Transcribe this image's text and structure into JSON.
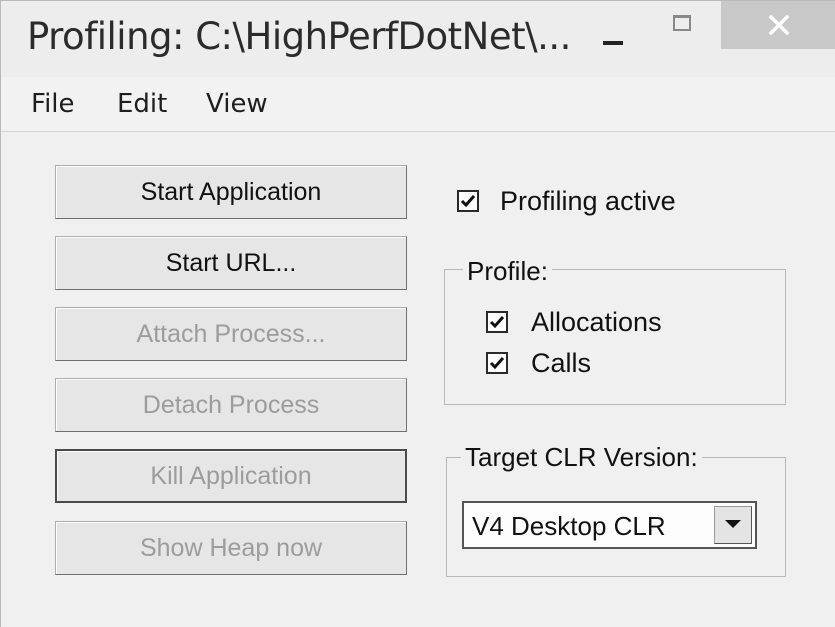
{
  "window": {
    "title": "Profiling: C:\\HighPerfDotNet\\..."
  },
  "menu": {
    "items": [
      {
        "label": "File"
      },
      {
        "label": "Edit"
      },
      {
        "label": "View"
      }
    ]
  },
  "actions": {
    "buttons": [
      {
        "label": "Start Application",
        "enabled": true
      },
      {
        "label": "Start URL...",
        "enabled": true
      },
      {
        "label": "Attach Process...",
        "enabled": false
      },
      {
        "label": "Detach Process",
        "enabled": false
      },
      {
        "label": "Kill Application",
        "enabled": false
      },
      {
        "label": "Show Heap now",
        "enabled": false
      }
    ]
  },
  "profiling_active": {
    "label": "Profiling active",
    "checked": true
  },
  "profile_group": {
    "legend": "Profile:",
    "options": [
      {
        "label": "Allocations",
        "checked": true
      },
      {
        "label": "Calls",
        "checked": true
      }
    ]
  },
  "clr_group": {
    "legend": "Target CLR Version:",
    "selected": "V4 Desktop CLR"
  },
  "icons": {
    "minimize": "minimize-icon",
    "maximize": "maximize-icon",
    "close": "close-icon",
    "check": "checkmark-icon",
    "dropdown": "chevron-down-icon"
  },
  "colors": {
    "window_bg": "#f0f0f0",
    "close_button_bg": "#c8c8c8",
    "disabled_text": "#9c9c9c"
  }
}
